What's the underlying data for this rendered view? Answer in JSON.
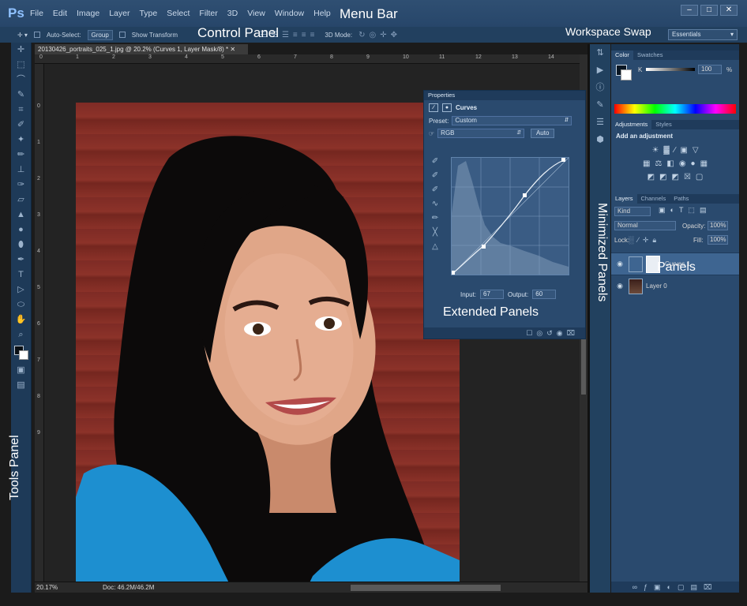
{
  "app": {
    "logo": "Ps"
  },
  "menu": {
    "items": [
      "File",
      "Edit",
      "Image",
      "Layer",
      "Type",
      "Select",
      "Filter",
      "3D",
      "View",
      "Window",
      "Help"
    ]
  },
  "window_controls": [
    "–",
    "□",
    "✕"
  ],
  "callouts": {
    "menu_bar": "Menu Bar",
    "control_panel": "Control Panel",
    "workspace_swap": "Workspace Swap",
    "tools_panel": "Tools Panel",
    "extended_panels": "Extended Panels",
    "minimized_panels": "Minimized Panels",
    "panels": "Panels"
  },
  "control_bar": {
    "auto_select": "Auto-Select:",
    "group": "Group",
    "show_transform": "Show Transform",
    "mode_3d": "3D Mode:"
  },
  "workspace": {
    "selected": "Essentials"
  },
  "document": {
    "tab": "20130426_portraits_025_1.jpg @ 20.2% (Curves 1, Layer Mask/8) *",
    "zoom": "20.17%",
    "doc_size": "Doc: 46.2M/46.2M"
  },
  "rulers": {
    "h": [
      "0",
      "1",
      "2",
      "3",
      "4",
      "5",
      "6",
      "7",
      "8",
      "9",
      "10",
      "11",
      "12",
      "13",
      "14"
    ],
    "v": [
      "0",
      "1",
      "2",
      "3",
      "4",
      "5",
      "6",
      "7",
      "8",
      "9"
    ]
  },
  "properties": {
    "tab": "Properties",
    "title": "Curves",
    "preset_label": "Preset:",
    "preset_value": "Custom",
    "channel": "RGB",
    "auto": "Auto",
    "input_label": "Input:",
    "input_value": "67",
    "output_label": "Output:",
    "output_value": "60"
  },
  "color_panel": {
    "tabs": [
      "Color",
      "Swatches"
    ],
    "k_label": "K",
    "k_value": "100",
    "pct": "%"
  },
  "adjustments_panel": {
    "tabs": [
      "Adjustments",
      "Styles"
    ],
    "title": "Add an adjustment"
  },
  "layers_panel": {
    "tabs": [
      "Layers",
      "Channels",
      "Paths"
    ],
    "kind": "Kind",
    "blend_mode": "Normal",
    "opacity_label": "Opacity:",
    "opacity_value": "100%",
    "lock_label": "Lock:",
    "fill_label": "Fill:",
    "fill_value": "100%",
    "layers": [
      {
        "name": "Curves 1",
        "selected": true
      },
      {
        "name": "Layer 0",
        "selected": false
      }
    ]
  }
}
